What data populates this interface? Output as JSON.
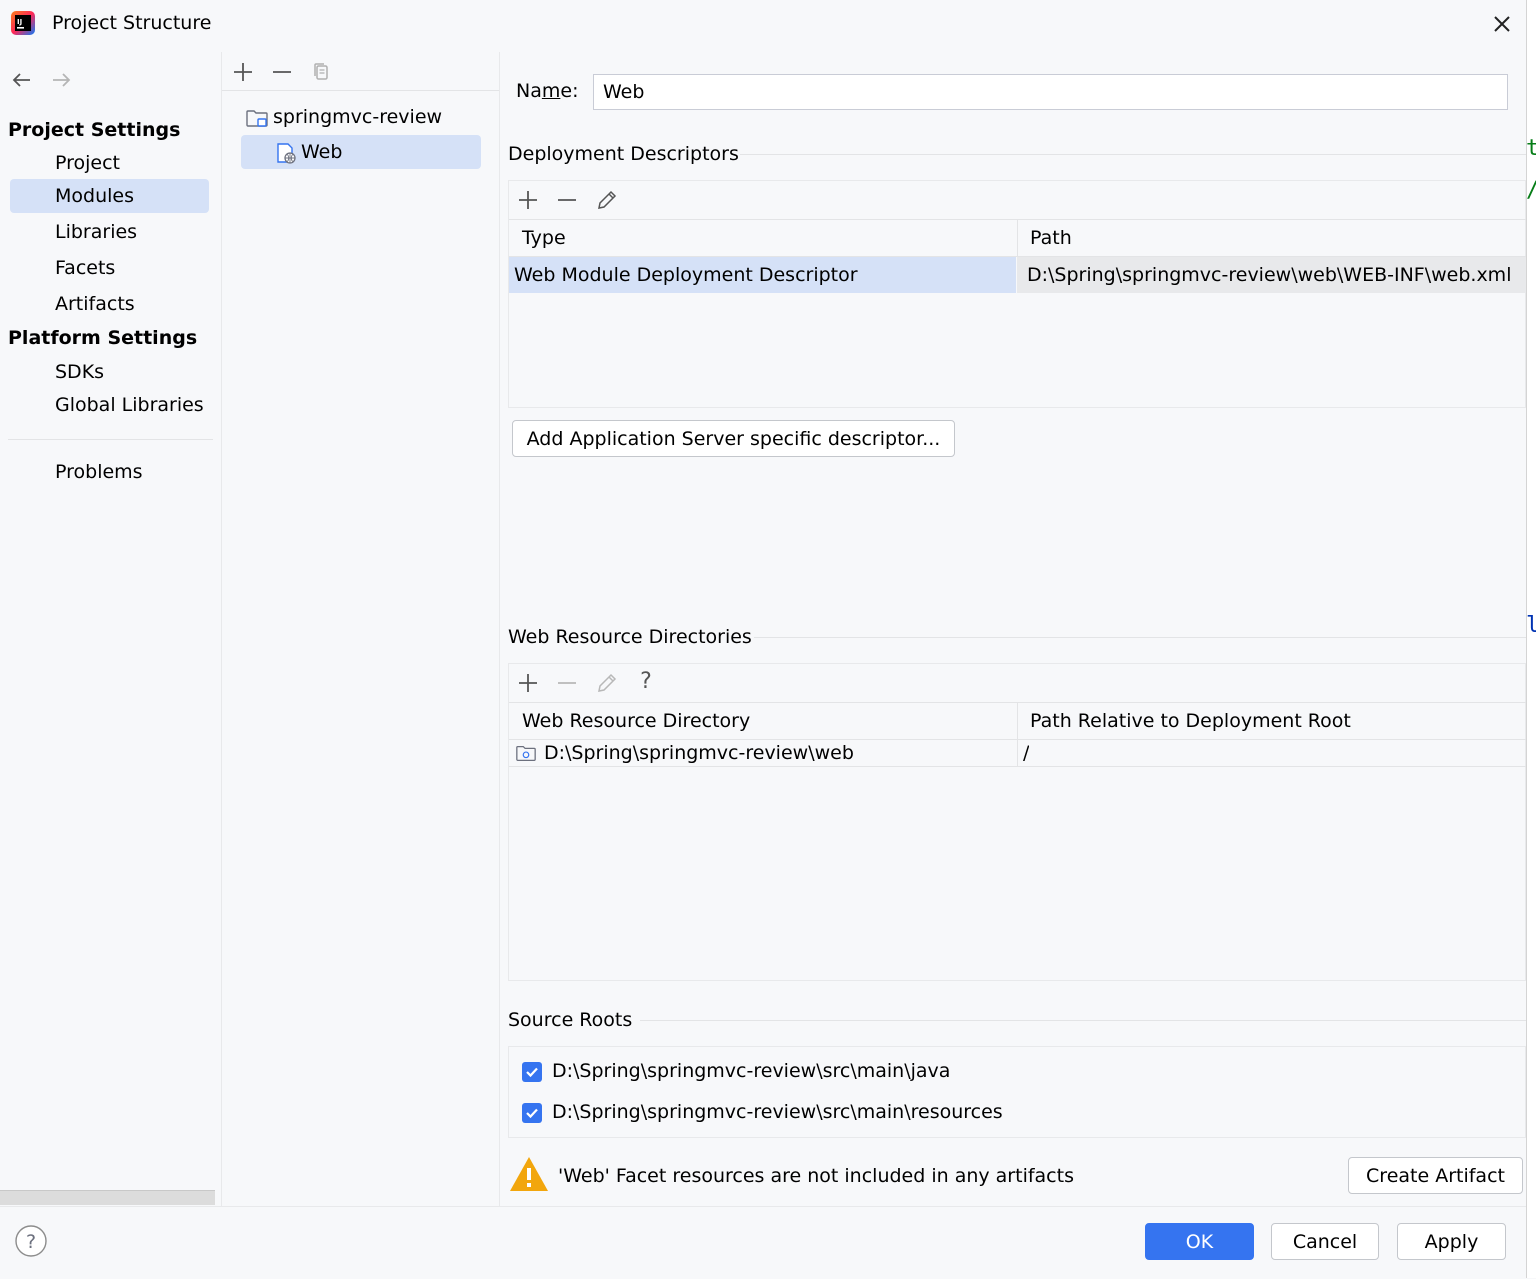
{
  "window": {
    "title": "Project Structure"
  },
  "icons": {
    "app": "intellij-idea-icon",
    "close": "close-icon",
    "back": "arrow-left-icon",
    "forward": "arrow-right-icon",
    "add": "plus-icon",
    "remove": "minus-icon",
    "copy": "copy-icon",
    "edit": "pencil-icon",
    "help": "question-icon",
    "warning": "warning-icon"
  },
  "nav": {
    "project_settings_heading": "Project Settings",
    "project_items": [
      "Project",
      "Modules",
      "Libraries",
      "Facets",
      "Artifacts"
    ],
    "selected": "Modules",
    "platform_settings_heading": "Platform Settings",
    "platform_items": [
      "SDKs",
      "Global Libraries"
    ],
    "problems": "Problems"
  },
  "tree": {
    "root": "springmvc-review",
    "child": "Web",
    "selected": "Web"
  },
  "main": {
    "name_label_pre": "Na",
    "name_label_mnemonic": "m",
    "name_label_post": "e:",
    "name_value": "Web",
    "deployment": {
      "title": "Deployment Descriptors",
      "columns": [
        "Type",
        "Path"
      ],
      "rows": [
        {
          "type": "Web Module Deployment Descriptor",
          "path": "D:\\Spring\\springmvc-review\\web\\WEB-INF\\web.xml"
        }
      ],
      "add_server_button": "Add Application Server specific descriptor..."
    },
    "web_resources": {
      "title": "Web Resource Directories",
      "help_glyph": "?",
      "columns": [
        "Web Resource Directory",
        "Path Relative to Deployment Root"
      ],
      "rows": [
        {
          "directory": "D:\\Spring\\springmvc-review\\web",
          "relative": "/"
        }
      ]
    },
    "source_roots": {
      "title": "Source Roots",
      "items": [
        {
          "path": "D:\\Spring\\springmvc-review\\src\\main\\java",
          "checked": true
        },
        {
          "path": "D:\\Spring\\springmvc-review\\src\\main\\resources",
          "checked": true
        }
      ]
    },
    "warning": {
      "message": "'Web' Facet resources are not included in any artifacts",
      "action": "Create Artifact"
    }
  },
  "footer": {
    "ok": "OK",
    "cancel": "Cancel",
    "apply": "Apply"
  },
  "editor_edge": {
    "chars": [
      "t",
      "/",
      "l"
    ]
  },
  "colors": {
    "accent": "#3574f0",
    "selection": "#d5e1f7",
    "warning": "#f2a60d"
  }
}
